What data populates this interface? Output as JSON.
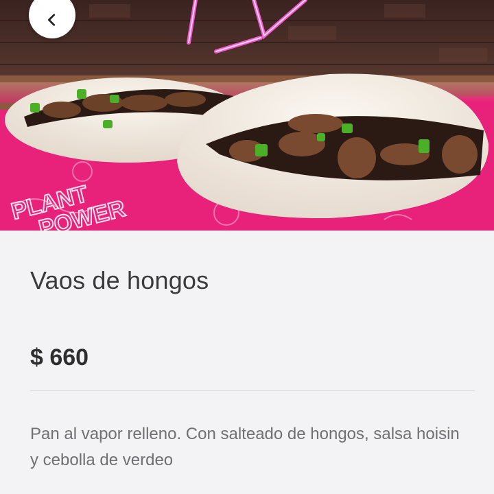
{
  "product": {
    "name": "Vaos de hongos",
    "price": "$ 660",
    "description": "Pan al vapor relleno. Con salteado de hongos, salsa hoisin y cebolla de verdeo",
    "image_alt": "Vaos de hongos"
  },
  "header": {
    "back_icon": "chevron-left-icon"
  },
  "colors": {
    "background": "#f3f3f5",
    "hero_accent": "#e8217a",
    "neon": "#ff5ad7"
  }
}
